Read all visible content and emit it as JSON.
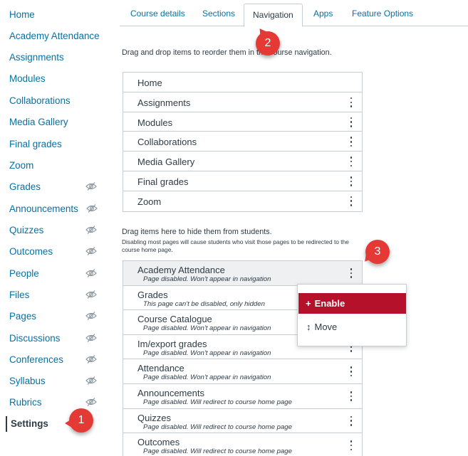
{
  "sidebar": {
    "items": [
      {
        "label": "Home",
        "hidden": false
      },
      {
        "label": "Academy Attendance",
        "hidden": false
      },
      {
        "label": "Assignments",
        "hidden": false
      },
      {
        "label": "Modules",
        "hidden": false
      },
      {
        "label": "Collaborations",
        "hidden": false
      },
      {
        "label": "Media Gallery",
        "hidden": false
      },
      {
        "label": "Final grades",
        "hidden": false
      },
      {
        "label": "Zoom",
        "hidden": false
      },
      {
        "label": "Grades",
        "hidden": true
      },
      {
        "label": "Announcements",
        "hidden": true
      },
      {
        "label": "Quizzes",
        "hidden": true
      },
      {
        "label": "Outcomes",
        "hidden": true
      },
      {
        "label": "People",
        "hidden": true
      },
      {
        "label": "Files",
        "hidden": true
      },
      {
        "label": "Pages",
        "hidden": true
      },
      {
        "label": "Discussions",
        "hidden": true
      },
      {
        "label": "Conferences",
        "hidden": true
      },
      {
        "label": "Syllabus",
        "hidden": true
      },
      {
        "label": "Rubrics",
        "hidden": true
      },
      {
        "label": "Settings",
        "hidden": false,
        "active": true
      }
    ]
  },
  "tabs": [
    {
      "label": "Course details"
    },
    {
      "label": "Sections"
    },
    {
      "label": "Navigation",
      "active": true
    },
    {
      "label": "Apps"
    },
    {
      "label": "Feature Options"
    }
  ],
  "navigation": {
    "drag_instruction": "Drag and drop items to reorder them in the course navigation.",
    "enabled_items": [
      "Home",
      "Assignments",
      "Modules",
      "Collaborations",
      "Media Gallery",
      "Final grades",
      "Zoom"
    ],
    "hide_instruction": "Drag items here to hide them from students.",
    "hide_note": "Disabling most pages will cause students who visit those pages to be redirected to the course home page.",
    "hidden_items": [
      {
        "label": "Academy Attendance",
        "note": "Page disabled. Won't appear in navigation"
      },
      {
        "label": "Grades",
        "note": "This page can't be disabled, only hidden"
      },
      {
        "label": "Course Catalogue",
        "note": "Page disabled. Won't appear in navigation"
      },
      {
        "label": "Im/export grades",
        "note": "Page disabled. Won't appear in navigation"
      },
      {
        "label": "Attendance",
        "note": "Page disabled. Won't appear in navigation"
      },
      {
        "label": "Announcements",
        "note": "Page disabled. Will redirect to course home page"
      },
      {
        "label": "Quizzes",
        "note": "Page disabled. Will redirect to course home page"
      },
      {
        "label": "Outcomes",
        "note": "Page disabled. Will redirect to course home page"
      }
    ]
  },
  "popup_menu": {
    "enable_icon": "+",
    "enable_label": "Enable",
    "move_icon": "↕",
    "move_label": "Move"
  },
  "badges": {
    "one": "1",
    "two": "2",
    "three": "3"
  },
  "colors": {
    "link": "#0770a3",
    "text": "#2d3b45",
    "enable_bg": "#b5112b",
    "badge": "#e53935",
    "border": "#c7cdd1"
  }
}
